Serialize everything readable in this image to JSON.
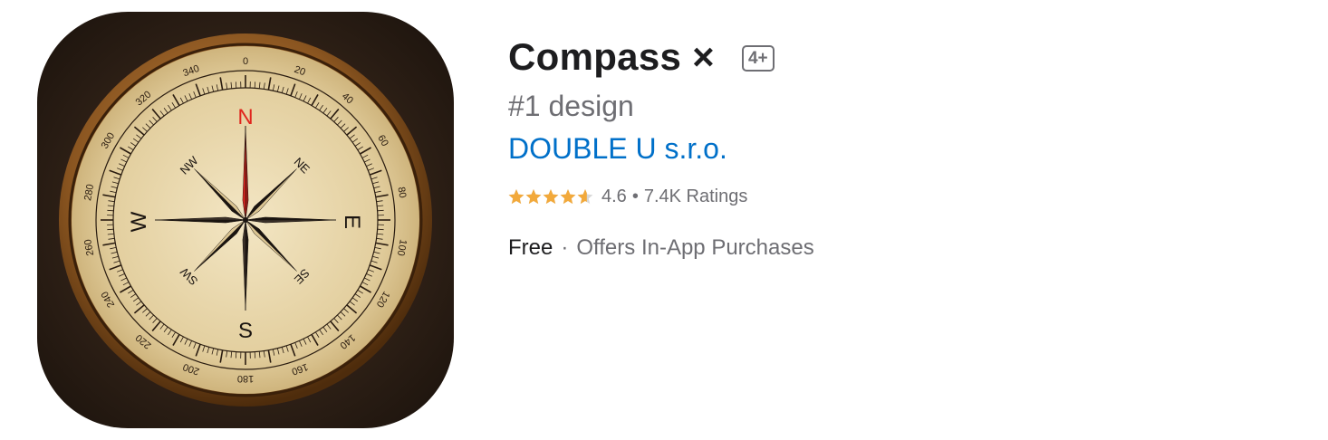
{
  "app": {
    "title": "Compass ×",
    "age_rating": "4+",
    "subtitle": "#1 design",
    "developer": "DOUBLE U s.r.o.",
    "rating_value": "4.6",
    "rating_separator": "•",
    "rating_count": "7.4K Ratings",
    "stars": 4.6,
    "star_color": "#f2a93b",
    "price": "Free",
    "price_separator": "·",
    "iap": "Offers In-App Purchases"
  },
  "icon": {
    "cardinals": {
      "north": "N",
      "east": "E",
      "south": "S",
      "west": "W"
    },
    "intercardinals": {
      "ne": "NE",
      "se": "SE",
      "sw": "SW",
      "nw": "NW"
    },
    "degree_labels": [
      "0",
      "20",
      "40",
      "60",
      "80",
      "100",
      "120",
      "140",
      "160",
      "180",
      "200",
      "220",
      "240",
      "260",
      "280",
      "300",
      "320",
      "340"
    ],
    "colors": {
      "bezel": "#7a4a1c",
      "dial": "#e9d7ae",
      "needle_red": "#e0261e",
      "ink": "#1a1410",
      "wood": "#2a1c12"
    }
  }
}
